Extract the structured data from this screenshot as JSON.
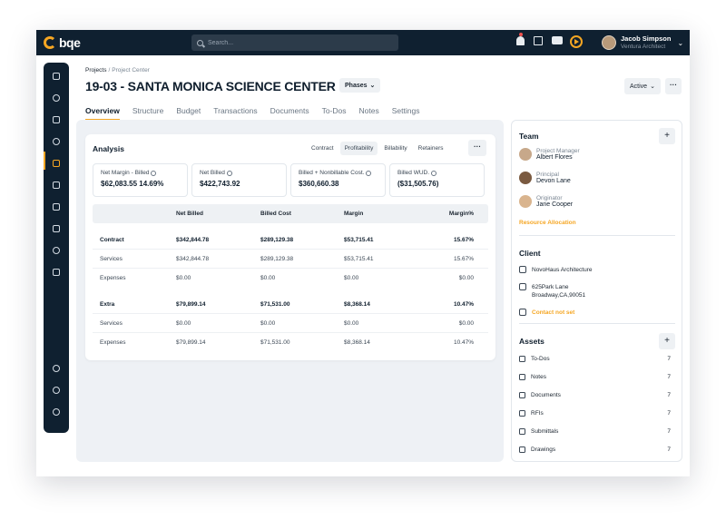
{
  "app": {
    "logo": "bqe"
  },
  "search": {
    "placeholder": "Search..."
  },
  "user": {
    "name": "Jacob Simpson",
    "role": "Ventura Architect"
  },
  "breadcrumb": {
    "parent": "Projects",
    "separator": "/",
    "current": "Project Center"
  },
  "project": {
    "title": "19-03 - SANTA MONICA SCIENCE CENTER",
    "phases_label": "Phases",
    "status": "Active"
  },
  "tabs": [
    "Overview",
    "Structure",
    "Budget",
    "Transactions",
    "Documents",
    "To-Dos",
    "Notes",
    "Settings"
  ],
  "analysis": {
    "title": "Analysis",
    "segments": [
      "Contract",
      "Profitability",
      "Billability",
      "Retainers"
    ],
    "active_segment": "Profitability",
    "kpis": [
      {
        "label": "Net Margin - Billed",
        "value": "$62,083.55  14.69%"
      },
      {
        "label": "Net Billed",
        "value": "$422,743.92"
      },
      {
        "label": "Billed + Nonbillable Cost.",
        "value": "$360,660.38"
      },
      {
        "label": "Billed WUD.",
        "value": "($31,505.76)"
      }
    ],
    "columns": [
      "",
      "Net Billed",
      "Billed Cost",
      "Margin",
      "Margin%"
    ],
    "rows": {
      "contract": [
        "Contract",
        "$342,844.78",
        "$289,129.38",
        "$53,715.41",
        "15.67%"
      ],
      "contract_services": [
        "Services",
        "$342,844.78",
        "$289,129.38",
        "$53,715.41",
        "15.67%"
      ],
      "contract_expenses": [
        "Expenses",
        "$0.00",
        "$0.00",
        "$0.00",
        "$0.00"
      ],
      "extra": [
        "Extra",
        "$79,899.14",
        "$71,531.00",
        "$8,368.14",
        "10.47%"
      ],
      "extra_services": [
        "Services",
        "$0.00",
        "$0.00",
        "$0.00",
        "$0.00"
      ],
      "extra_expenses": [
        "Expenses",
        "$79,899.14",
        "$71,531.00",
        "$8,368.14",
        "10.47%"
      ]
    }
  },
  "team": {
    "title": "Team",
    "members": [
      {
        "role": "Project Manager",
        "name": "Albert Flores"
      },
      {
        "role": "Principal",
        "name": "Devon Lane"
      },
      {
        "role": "Originator",
        "name": "Jane Cooper"
      }
    ],
    "link": "Resource Allocation"
  },
  "client": {
    "title": "Client",
    "name": "NovoHaus Architecture",
    "address_line1": "625Park Lane",
    "address_line2": "Broadway,CA,90051",
    "contact": "Contact not set"
  },
  "assets": {
    "title": "Assets",
    "items": [
      {
        "label": "To-Dos",
        "count": "7"
      },
      {
        "label": "Notes",
        "count": "7"
      },
      {
        "label": "Documents",
        "count": "7"
      },
      {
        "label": "RFIs",
        "count": "7"
      },
      {
        "label": "Submittals",
        "count": "7"
      },
      {
        "label": "Drawings",
        "count": "7"
      }
    ]
  },
  "colors": {
    "accent": "#f5a623",
    "nav_bg": "#0f2030",
    "panel_bg": "#eef1f5"
  }
}
